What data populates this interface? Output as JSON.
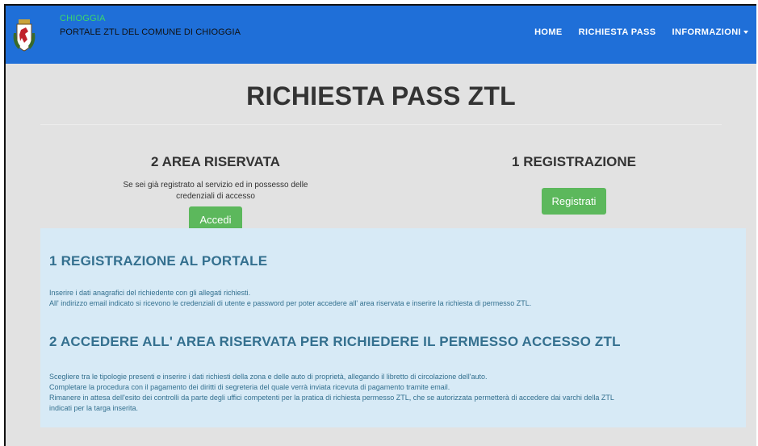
{
  "header": {
    "brand_small": "CHIOGGIA",
    "brand_main": "PORTALE ZTL DEL COMUNE DI CHIOGGIA",
    "nav": [
      "HOME",
      "RICHIESTA PASS",
      "INFORMAZIONI"
    ]
  },
  "main": {
    "title": "RICHIESTA PASS ZTL",
    "left": {
      "title": "2 AREA RISERVATA",
      "desc_line1": "Se sei già registrato al servizio ed in possesso delle",
      "desc_line2": "credenziali di accesso",
      "button": "Accedi"
    },
    "right": {
      "title": "1 REGISTRAZIONE",
      "button": "Registrati"
    },
    "info": {
      "h1": "1 REGISTRAZIONE AL PORTALE",
      "p1": [
        "Inserire i dati anagrafici del richiedente con gli allegati richiesti.",
        "All' indirizzo email indicato si ricevono le credenziali di utente e password per poter accedere all' area riservata e inserire la richiesta di permesso ZTL."
      ],
      "h2": "2 ACCEDERE ALL' AREA RISERVATA PER RICHIEDERE IL PERMESSO ACCESSO ZTL",
      "p2": [
        "Scegliere tra le tipologie presenti e inserire i dati richiesti della zona e delle auto di proprietà, allegando il libretto di circolazione dell'auto.",
        "Completare la procedura con il pagamento dei diritti di segreteria del quale verrà inviata ricevuta di pagamento tramite email.",
        "Rimanere in attesa dell'esito dei controlli da parte degli uffici competenti per la pratica di richiesta permesso ZTL, che se autorizzata permetterà di accedere dai varchi della ZTL",
        "indicati per la targa inserita."
      ]
    }
  },
  "colors": {
    "navbar": "#1f6fd8",
    "page_bg": "#e2e2e2",
    "button": "#5cb85c",
    "info_bg": "#d7eaf6",
    "info_text": "#34708f"
  },
  "icons": {
    "logo": "chioggia-coat-of-arms-icon",
    "dropdown": "caret-down-icon"
  }
}
